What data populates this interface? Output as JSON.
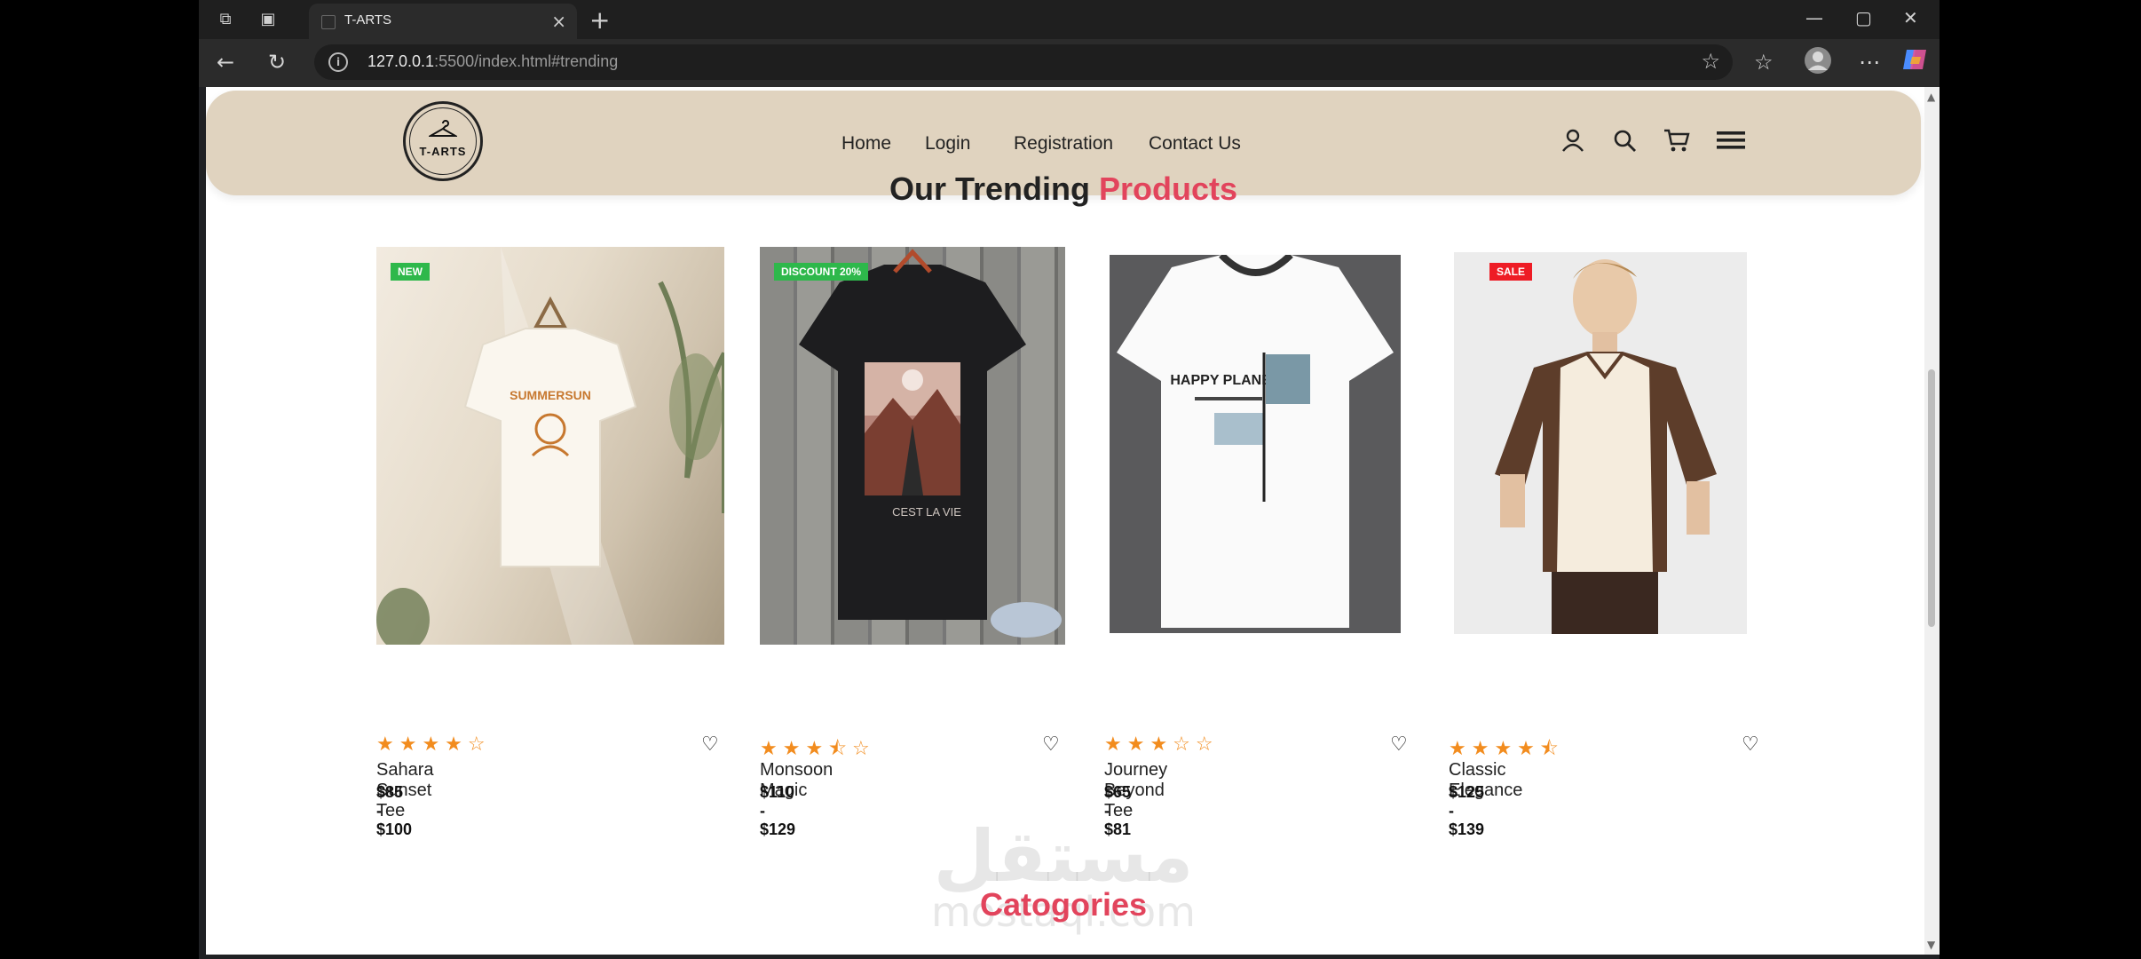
{
  "browser": {
    "tab_title": "T-ARTS",
    "url_host": "127.0.0.1",
    "url_path": ":5500/index.html#trending"
  },
  "header": {
    "logo_text": "T-ARTS",
    "nav": [
      "Home",
      "Login",
      "Registration",
      "Contact Us"
    ]
  },
  "trending": {
    "title_dark": "Our Trending",
    "title_accent": "Products",
    "products": [
      {
        "name": "Sahara Sunset Tee",
        "price": "$85 - $100",
        "badge": "NEW",
        "badge_color": "#2eb84b",
        "rating": 4,
        "print": "SUMMERSUN"
      },
      {
        "name": "Monsoon Magic",
        "price": "$110 - $129",
        "badge": "DISCOUNT 20%",
        "badge_color": "#2eb84b",
        "rating": 3.5,
        "print": "CEST LA VIE"
      },
      {
        "name": "Journey Beyond Tee",
        "price": "$65 - $81",
        "badge": "",
        "badge_color": "",
        "rating": 3,
        "print": "HAPPY PLANET"
      },
      {
        "name": "Classic Elegance",
        "price": "$125 - $139",
        "badge": "SALE",
        "badge_color": "#ee1c25",
        "rating": 4.5,
        "print": ""
      }
    ]
  },
  "categories": {
    "title": "Catogories"
  },
  "watermark": {
    "text": "مستقل",
    "sub": "mostaql.com"
  },
  "colors": {
    "header_bg": "#e0d3bf",
    "accent": "#e2445c",
    "star": "#f28c1e"
  }
}
